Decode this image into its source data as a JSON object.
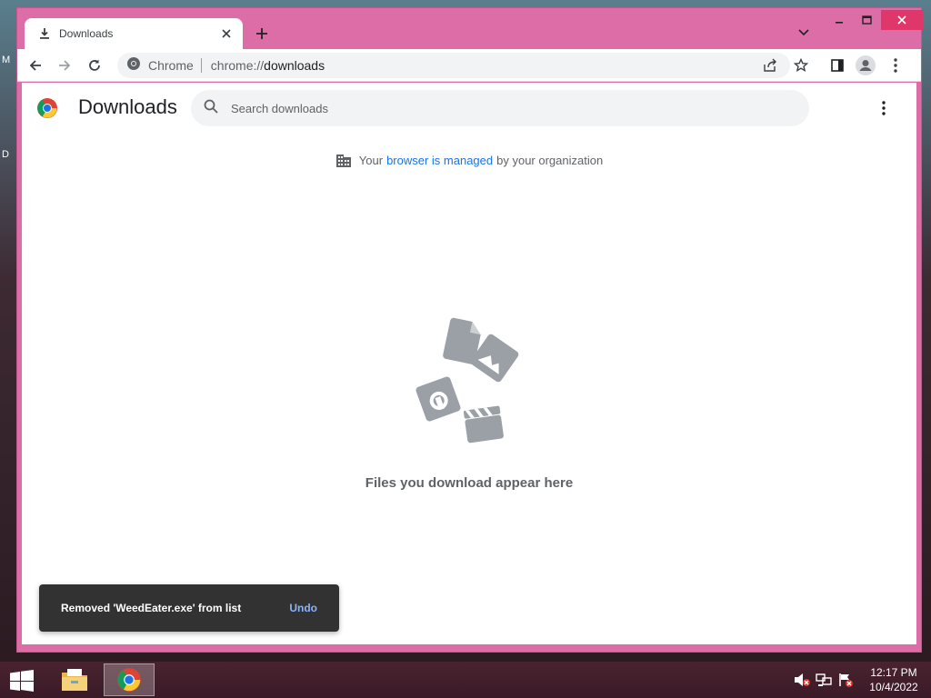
{
  "desktop": {
    "edge_top": "M",
    "edge_mid": "D"
  },
  "tab": {
    "title": "Downloads"
  },
  "omnibox": {
    "site": "Chrome",
    "url_scheme": "chrome://",
    "url_path": "downloads"
  },
  "page": {
    "title": "Downloads",
    "search_placeholder": "Search downloads",
    "managed_prefix": "Your",
    "managed_link": "browser is managed",
    "managed_suffix": "by your organization",
    "empty_message": "Files you download appear here"
  },
  "toast": {
    "message": "Removed 'WeedEater.exe' from list",
    "action": "Undo"
  },
  "taskbar": {
    "time": "12:17 PM",
    "date": "10/4/2022"
  },
  "colors": {
    "window_frame": "#dc6da6",
    "close_button": "#e0376a",
    "link": "#1a73e8",
    "toast_bg": "#323232",
    "toast_action": "#8ab4f8"
  }
}
